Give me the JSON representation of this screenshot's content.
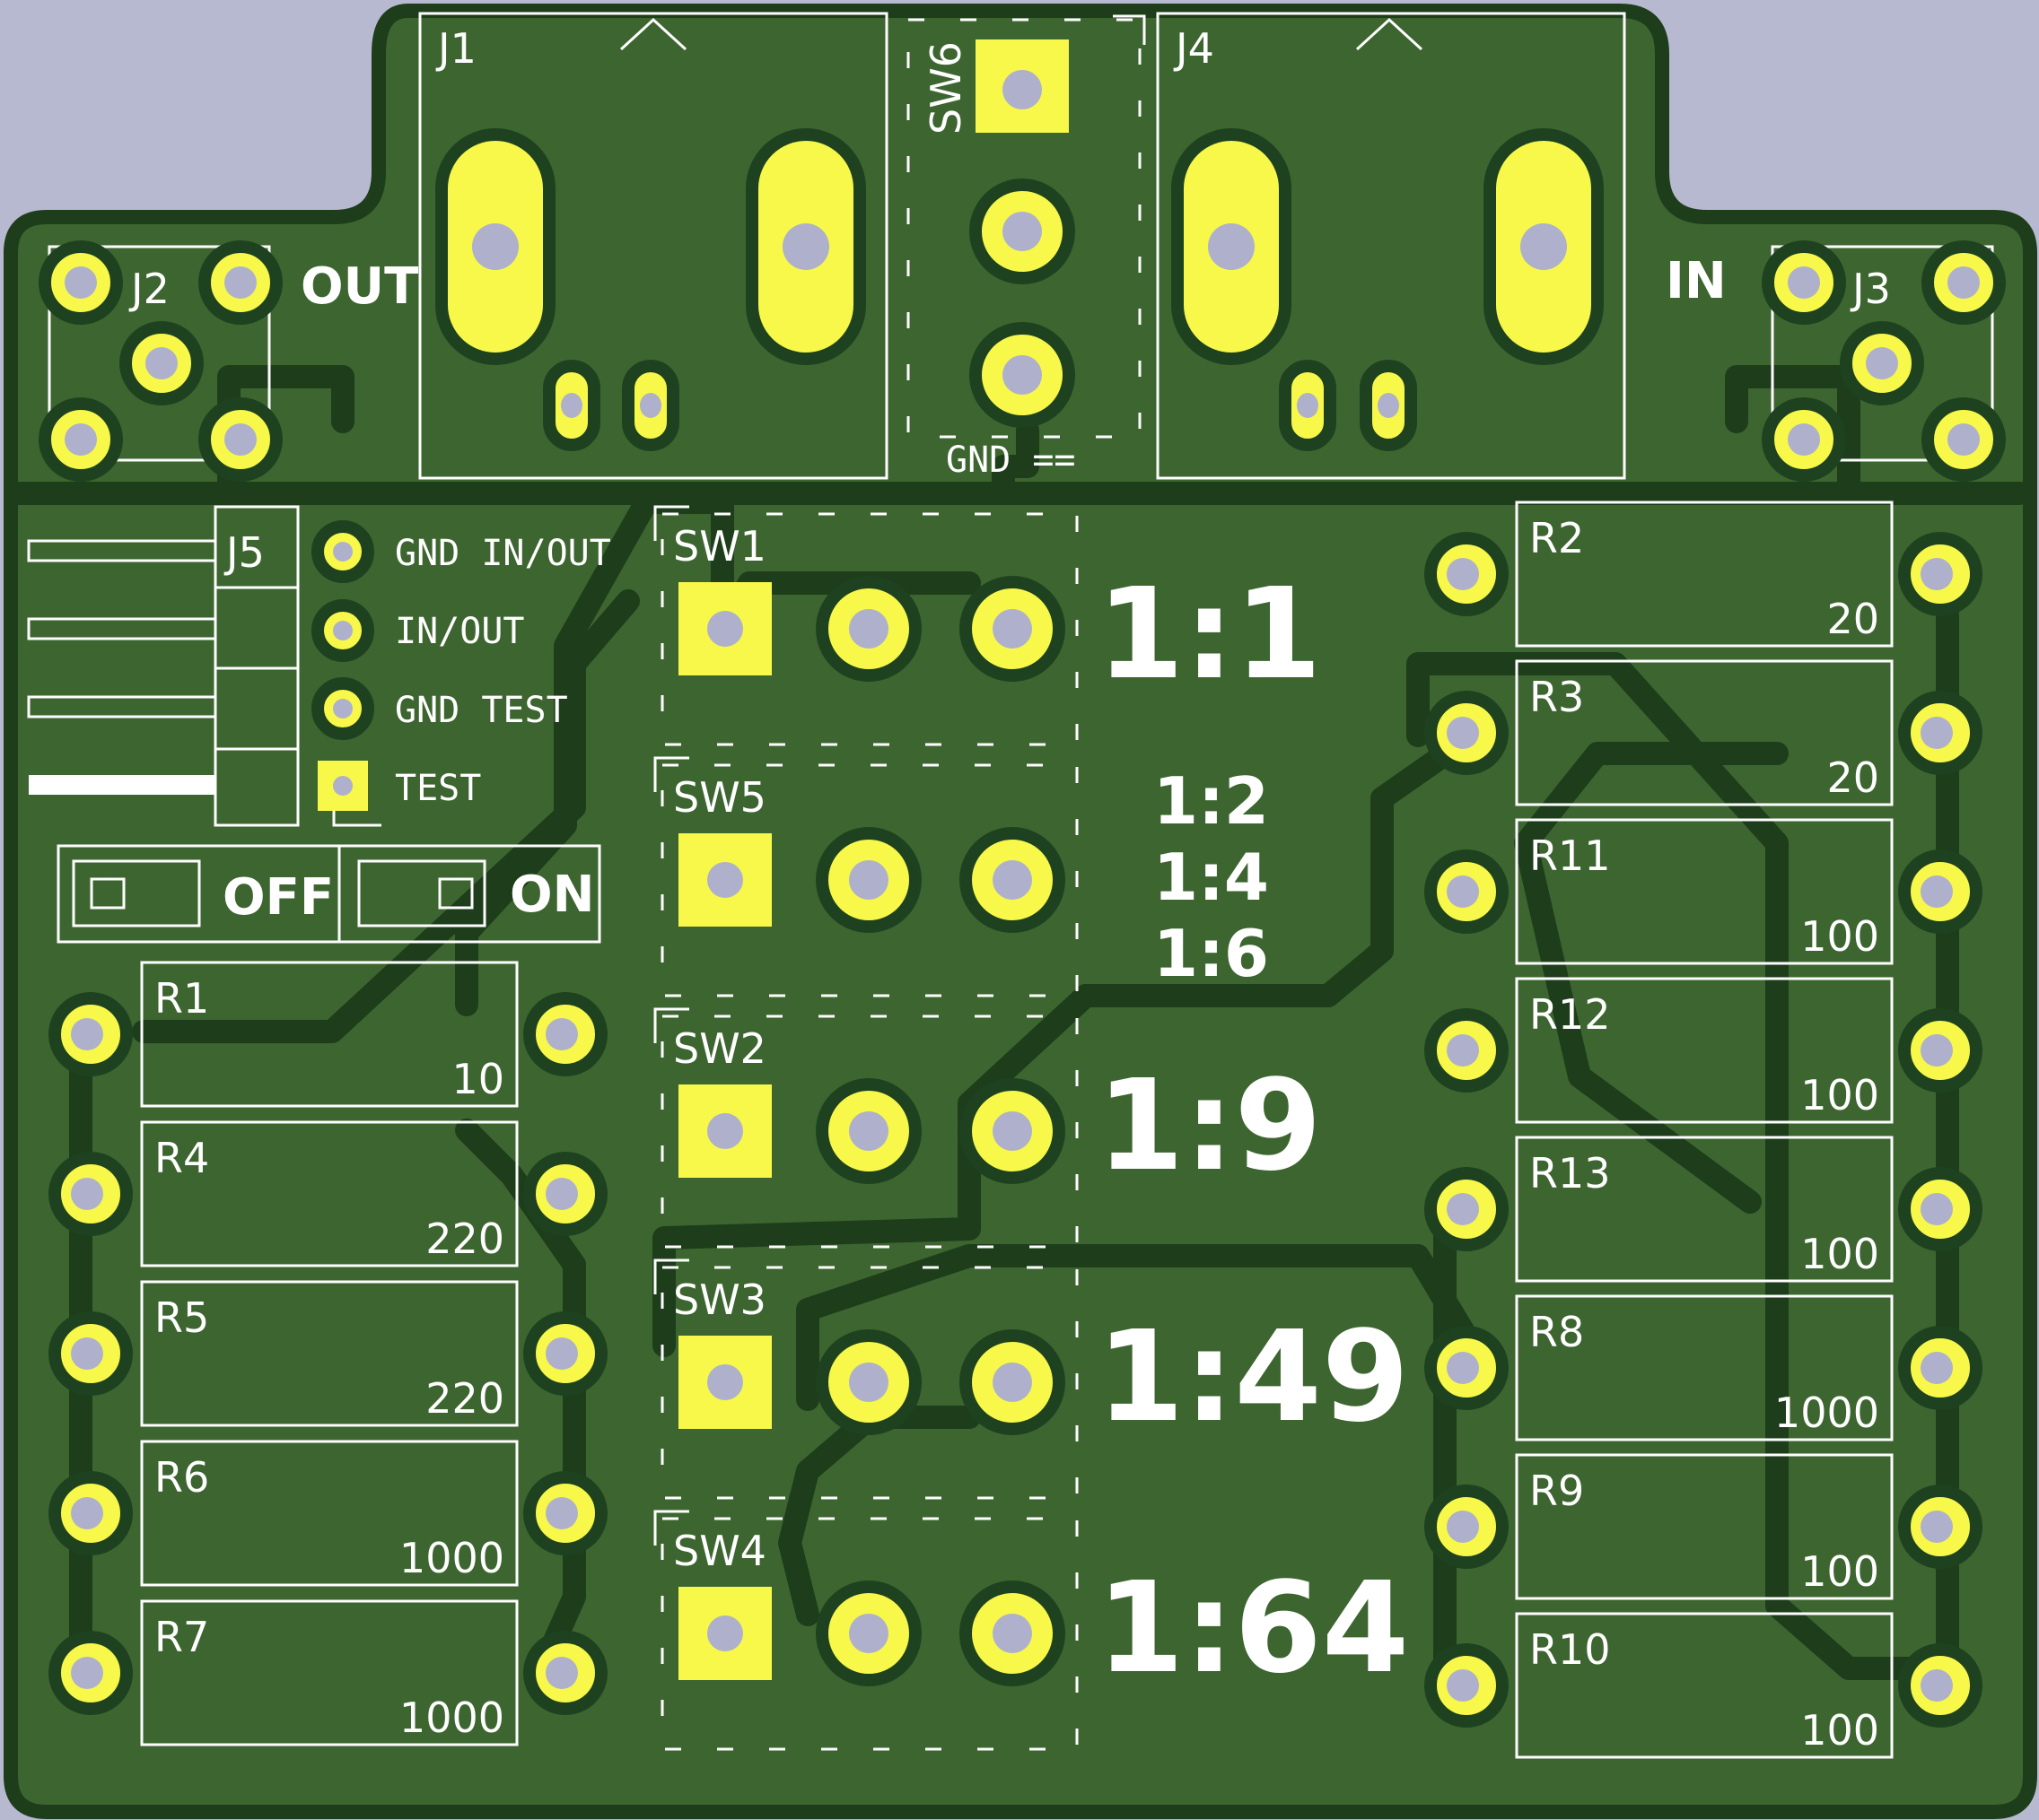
{
  "board": {
    "colors": {
      "background": "#b6b9cf",
      "board": "#3d6530",
      "copper": "#f8f84a",
      "silkscreen": "#ffffff",
      "trace": "#1d3d1b"
    }
  },
  "connectors": {
    "j1": "J1",
    "j2": "J2",
    "j3": "J3",
    "j4": "J4",
    "j5": "J5",
    "out_label": "OUT",
    "in_label": "IN"
  },
  "sw6": {
    "ref": "SW6",
    "gnd_label": "GND =="
  },
  "j5_pins": [
    "GND IN/OUT",
    "IN/OUT",
    "GND TEST",
    "TEST"
  ],
  "power_switch": {
    "off_label": "OFF",
    "on_label": "ON"
  },
  "switches": [
    {
      "ref": "SW1",
      "ratio": "1:1"
    },
    {
      "ref": "SW5",
      "ratio_lines": [
        "1:2",
        "1:4",
        "1:6"
      ]
    },
    {
      "ref": "SW2",
      "ratio": "1:9"
    },
    {
      "ref": "SW3",
      "ratio": "1:49"
    },
    {
      "ref": "SW4",
      "ratio": "1:64"
    }
  ],
  "resistors_left": [
    {
      "ref": "R1",
      "value": "10"
    },
    {
      "ref": "R4",
      "value": "220"
    },
    {
      "ref": "R5",
      "value": "220"
    },
    {
      "ref": "R6",
      "value": "1000"
    },
    {
      "ref": "R7",
      "value": "1000"
    }
  ],
  "resistors_right": [
    {
      "ref": "R2",
      "value": "20"
    },
    {
      "ref": "R3",
      "value": "20"
    },
    {
      "ref": "R11",
      "value": "100"
    },
    {
      "ref": "R12",
      "value": "100"
    },
    {
      "ref": "R13",
      "value": "100"
    },
    {
      "ref": "R8",
      "value": "1000"
    },
    {
      "ref": "R9",
      "value": "100"
    },
    {
      "ref": "R10",
      "value": "100"
    }
  ]
}
